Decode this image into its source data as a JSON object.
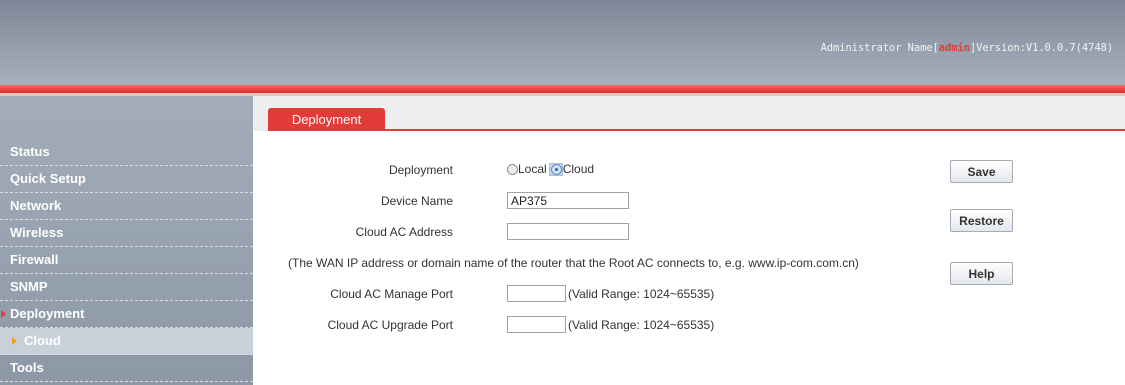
{
  "header": {
    "admin_prefix": "Administrator Name[",
    "admin_name": "admin",
    "version_text": "]Version:V1.0.0.7(4748)"
  },
  "sidebar": {
    "items": [
      {
        "label": "Status"
      },
      {
        "label": "Quick Setup"
      },
      {
        "label": "Network"
      },
      {
        "label": "Wireless"
      },
      {
        "label": "Firewall"
      },
      {
        "label": "SNMP"
      },
      {
        "label": "Deployment"
      },
      {
        "label": "Cloud"
      },
      {
        "label": "Tools"
      }
    ]
  },
  "tab": {
    "label": "Deployment"
  },
  "form": {
    "deployment_label": "Deployment",
    "deployment_options": [
      "Local",
      "Cloud"
    ],
    "deployment_selected": "Cloud",
    "device_name_label": "Device Name",
    "device_name_value": "AP375",
    "cloud_ac_address_label": "Cloud AC Address",
    "cloud_ac_address_value": "",
    "wan_note": "(The WAN IP address or domain name of the router that the Root AC connects to, e.g. www.ip-com.com.cn)",
    "manage_port_label": "Cloud AC Manage Port",
    "manage_port_value": "",
    "manage_port_hint": "(Valid Range: 1024~65535)",
    "upgrade_port_label": "Cloud AC Upgrade Port",
    "upgrade_port_value": "",
    "upgrade_port_hint": "(Valid Range: 1024~65535)"
  },
  "buttons": {
    "save": "Save",
    "restore": "Restore",
    "help": "Help"
  },
  "colors": {
    "accent_red": "#e33a3a",
    "sidebar_gray": "#98a2af"
  }
}
